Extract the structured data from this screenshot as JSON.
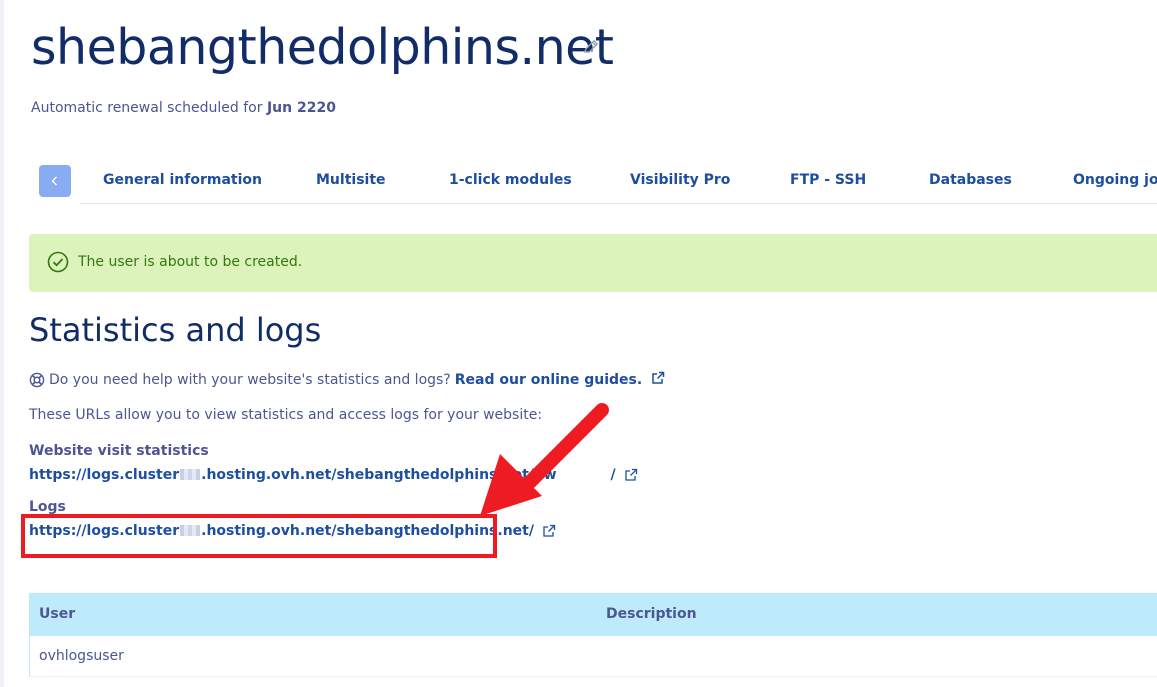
{
  "header": {
    "domain": "shebangthedolphins.net",
    "renewal_prefix": "Automatic renewal scheduled for",
    "renewal_date": "Jun 2220"
  },
  "tabs": [
    {
      "label": "General information"
    },
    {
      "label": "Multisite"
    },
    {
      "label": "1-click modules"
    },
    {
      "label": "Visibility Pro"
    },
    {
      "label": "FTP - SSH"
    },
    {
      "label": "Databases"
    },
    {
      "label": "Ongoing job"
    }
  ],
  "alert": {
    "message": "The user is about to be created.",
    "color": "#33790e",
    "background": "#dcf3bb"
  },
  "stats": {
    "title": "Statistics and logs",
    "help_text": "Do you need help with your website's statistics and logs?",
    "help_link": "Read our online guides.",
    "intro": "These URLs allow you to view statistics and access logs for your website:",
    "visit_label": "Website visit statistics",
    "visit_url_prefix": "https://logs.cluster",
    "visit_url_suffix": ".hosting.ovh.net/shebangthedolphins.net/ow",
    "visit_url_tail": "/",
    "logs_label": "Logs",
    "logs_url_prefix": "https://logs.cluster",
    "logs_url_suffix": ".hosting.ovh.net/shebangthedolphins.net/"
  },
  "users_table": {
    "columns": [
      "User",
      "Description"
    ],
    "rows": [
      {
        "user": "ovhlogsuser",
        "description": ""
      }
    ]
  },
  "annotation": {
    "color": "#ee1c22"
  }
}
